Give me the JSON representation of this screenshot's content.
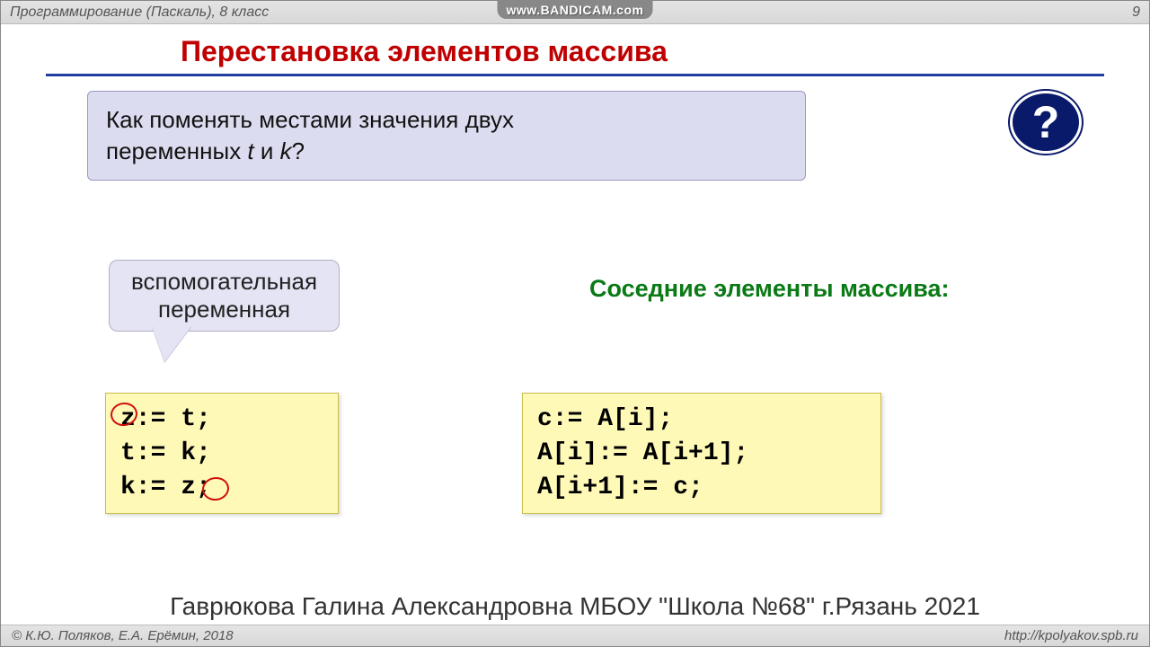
{
  "header": {
    "left": "Программирование (Паскаль), 8 класс",
    "page": "9",
    "watermark": "www.BANDICAM.com"
  },
  "title": "Перестановка элементов массива",
  "question": {
    "line1": "Как поменять местами значения двух",
    "line2_prefix": "переменных ",
    "var1": "t",
    "mid": " и ",
    "var2": "k",
    "suffix": "?"
  },
  "qmark": "?",
  "callout": {
    "l1": "вспомогательная",
    "l2": "переменная"
  },
  "code1": "z:= t;\nt:= k;\nk:= z;",
  "green_heading": "Соседние элементы массива:",
  "code2": "c:= A[i];\nA[i]:= A[i+1];\nA[i+1]:= c;",
  "teacher_credit": "Гаврюкова Галина Александровна МБОУ \"Школа №68\" г.Рязань 2021",
  "footer": {
    "left": "© К.Ю. Поляков, Е.А. Ерёмин, 2018",
    "right": "http://kpolyakov.spb.ru"
  }
}
